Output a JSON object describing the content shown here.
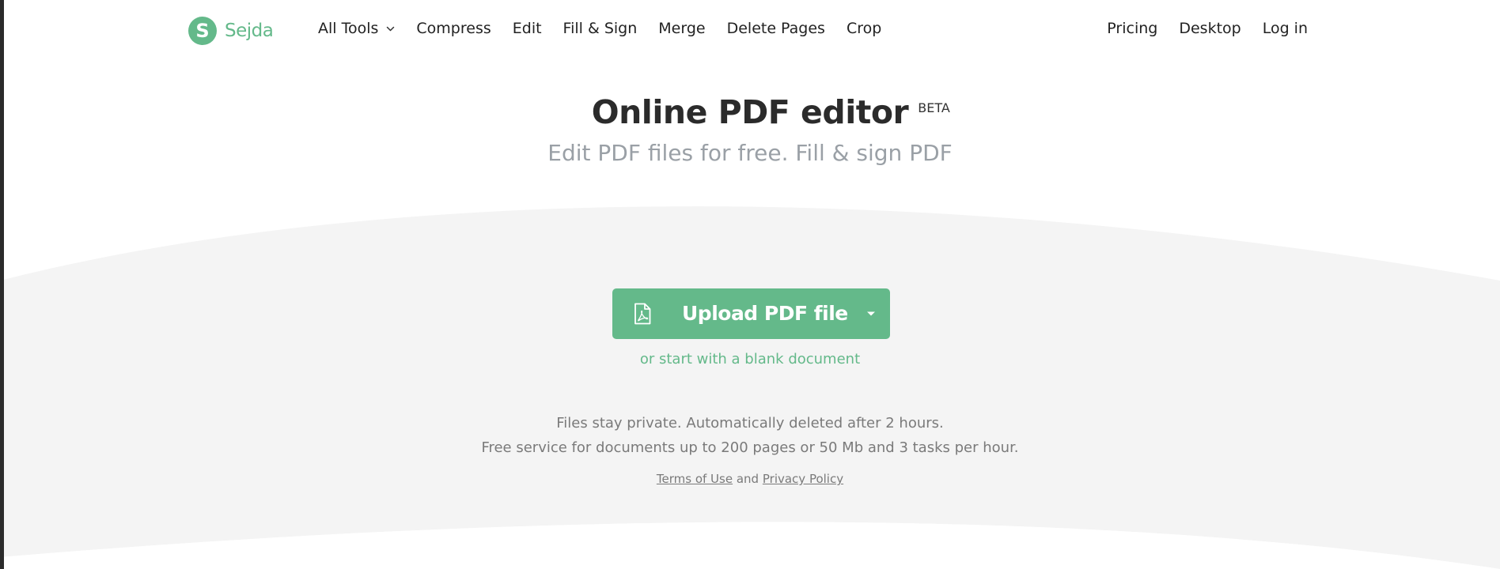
{
  "colors": {
    "brand": "#64b98a",
    "title": "#2b2b2b",
    "subtitle": "#9aa0a6",
    "muted": "#7a7a7a",
    "band": "#f4f4f4"
  },
  "header": {
    "logo_icon": "sejda-s-logo-icon",
    "logo_letter": "S",
    "logo_text": "Sejda",
    "nav_left": [
      {
        "label": "All Tools",
        "icon": "chevron-down-icon"
      },
      {
        "label": "Compress"
      },
      {
        "label": "Edit"
      },
      {
        "label": "Fill & Sign"
      },
      {
        "label": "Merge"
      },
      {
        "label": "Delete Pages"
      },
      {
        "label": "Crop"
      }
    ],
    "nav_right": [
      {
        "label": "Pricing"
      },
      {
        "label": "Desktop"
      },
      {
        "label": "Log in"
      }
    ]
  },
  "hero": {
    "title": "Online PDF editor",
    "badge": "BETA",
    "subtitle": "Edit PDF files for free. Fill & sign PDF"
  },
  "upload": {
    "icon": "pdf-file-icon",
    "label": "Upload PDF file",
    "caret_icon": "caret-down-icon",
    "blank_link": "or start with a blank document"
  },
  "info": {
    "line1": "Files stay private. Automatically deleted after 2 hours.",
    "line2": "Free service for documents up to 200 pages or 50 Mb and 3 tasks per hour."
  },
  "legal": {
    "terms": "Terms of Use",
    "and": "and",
    "privacy": "Privacy Policy"
  }
}
